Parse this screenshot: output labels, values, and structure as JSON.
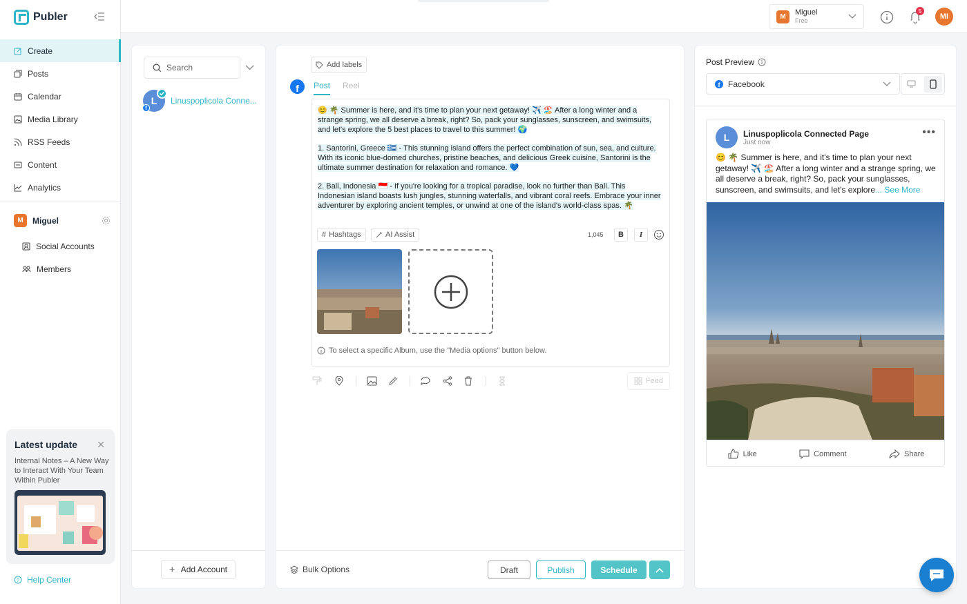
{
  "app": {
    "name": "Publer"
  },
  "sidebar": {
    "items": [
      {
        "label": "Create",
        "icon": "edit-icon"
      },
      {
        "label": "Posts",
        "icon": "posts-icon"
      },
      {
        "label": "Calendar",
        "icon": "calendar-icon"
      },
      {
        "label": "Media Library",
        "icon": "image-icon"
      },
      {
        "label": "RSS Feeds",
        "icon": "rss-icon"
      },
      {
        "label": "Content",
        "icon": "content-icon"
      },
      {
        "label": "Analytics",
        "icon": "analytics-icon"
      }
    ],
    "workspace": {
      "initial": "M",
      "name": "Miguel"
    },
    "sub_items": [
      {
        "label": "Social Accounts"
      },
      {
        "label": "Members"
      }
    ],
    "update": {
      "title": "Latest update",
      "text": "Internal Notes – A New Way to Interact With Your Team Within Publer"
    },
    "help_label": "Help Center"
  },
  "topbar": {
    "user": {
      "initial": "M",
      "name": "Miguel",
      "plan": "Free"
    },
    "notification_count": "5",
    "avatar_initials": "MI"
  },
  "accounts": {
    "search_placeholder": "Search",
    "account_initial": "L",
    "account_name": "Linuspoplicola Conne...",
    "add_account": "Add Account"
  },
  "composer": {
    "add_labels": "Add labels",
    "tabs": {
      "post": "Post",
      "reel": "Reel"
    },
    "paragraphs": [
      "😊 🌴 Summer is here, and it's time to plan your next getaway! ✈️ 🏖️ After a long winter and a strange spring, we all deserve a break, right? So, pack your sunglasses, sunscreen, and swimsuits, and let's explore the 5 best places to travel to this summer! 🌍",
      "1. Santorini, Greece 🇬🇷 - This stunning island offers the perfect combination of sun, sea, and culture. With its iconic blue-domed churches, pristine beaches, and delicious Greek cuisine, Santorini is the ultimate summer destination for relaxation and romance. 💙",
      "2. Bali, Indonesia 🇮🇩 - If you're looking for a tropical paradise, look no further than Bali. This Indonesian island boasts lush jungles, stunning waterfalls, and vibrant coral reefs. Embrace your inner adventurer by exploring ancient temples, or unwind at one of the island's world-class spas. 🌴"
    ],
    "hashtags": "Hashtags",
    "ai_assist": "AI Assist",
    "char_count": "1,045",
    "bold": "B",
    "italic": "I",
    "hint": "To select a specific Album, use the \"Media options\" button below.",
    "feed": "Feed",
    "bulk_options": "Bulk Options",
    "draft": "Draft",
    "publish": "Publish",
    "schedule": "Schedule"
  },
  "preview": {
    "title": "Post Preview",
    "network": "Facebook",
    "page_initial": "L",
    "page_name": "Linuspoplicola Connected Page",
    "time": "Just now",
    "text": "😊 🌴 Summer is here, and it's time to plan your next getaway! ✈️ 🏖️ After a long winter and a strange spring, we all deserve a break, right? So, pack your sunglasses, sunscreen, and swimsuits, and let's explore",
    "see_more": "... See More",
    "like": "Like",
    "comment": "Comment",
    "share": "Share"
  },
  "colors": {
    "accent": "#2fb5c8",
    "facebook": "#1877f2",
    "orange": "#e8762e",
    "badge": "#e5304a"
  }
}
